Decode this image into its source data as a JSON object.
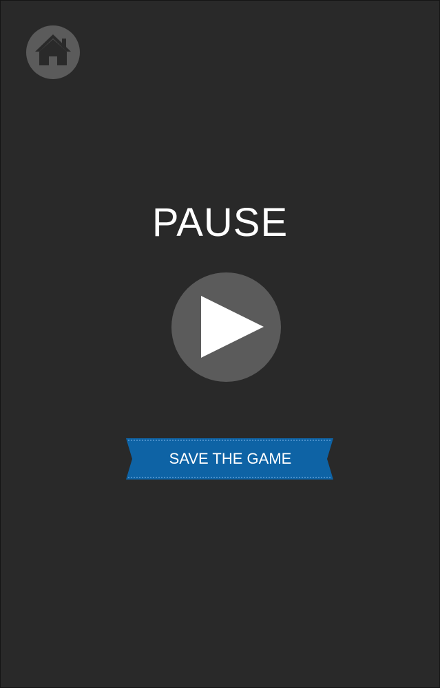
{
  "pause_screen": {
    "title": "PAUSE",
    "save_button_label": "SAVE THE GAME",
    "home_icon": "home-icon",
    "play_icon": "play-icon"
  },
  "colors": {
    "background": "#292929",
    "button_circle": "#5b5b5b",
    "icon_dark": "#2a2a2a",
    "icon_light": "#ffffff",
    "ribbon_blue": "#0e63a5",
    "ribbon_stitch": "#5c9bd3",
    "text": "#ffffff"
  }
}
